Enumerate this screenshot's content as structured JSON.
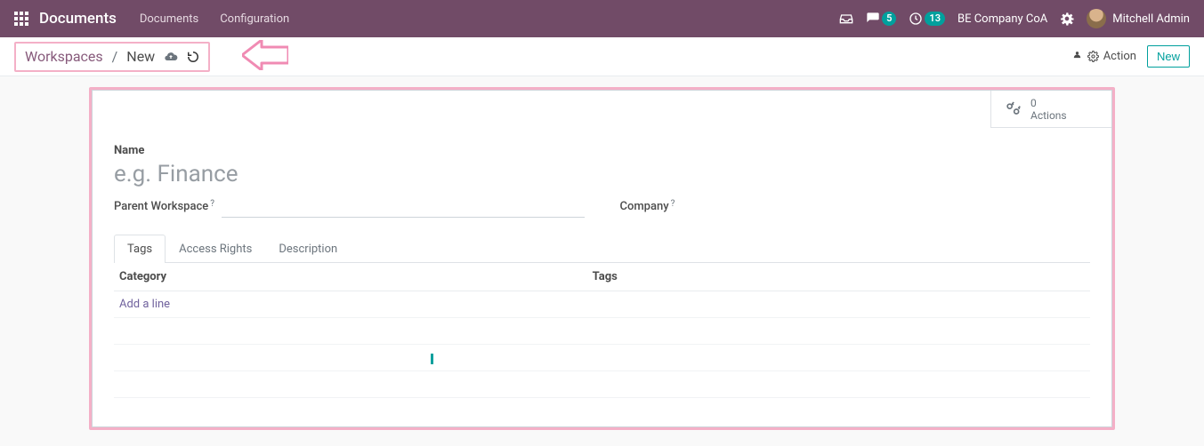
{
  "header": {
    "brand": "Documents",
    "menu": [
      "Documents",
      "Configuration"
    ],
    "messages_count": "5",
    "activities_count": "13",
    "company": "BE Company CoA",
    "user": "Mitchell Admin"
  },
  "breadcrumb": {
    "root": "Workspaces",
    "current": "New"
  },
  "controls": {
    "action_label": "Action",
    "new_label": "New"
  },
  "stat": {
    "count": "0",
    "label": "Actions"
  },
  "form": {
    "name_label": "Name",
    "name_placeholder": "e.g. Finance",
    "name_value": "",
    "parent_label": "Parent Workspace",
    "parent_value": "",
    "company_label": "Company",
    "company_value": ""
  },
  "tabs": {
    "tags": "Tags",
    "access": "Access Rights",
    "description": "Description"
  },
  "grid": {
    "col_category": "Category",
    "col_tags": "Tags",
    "add_line": "Add a line"
  }
}
